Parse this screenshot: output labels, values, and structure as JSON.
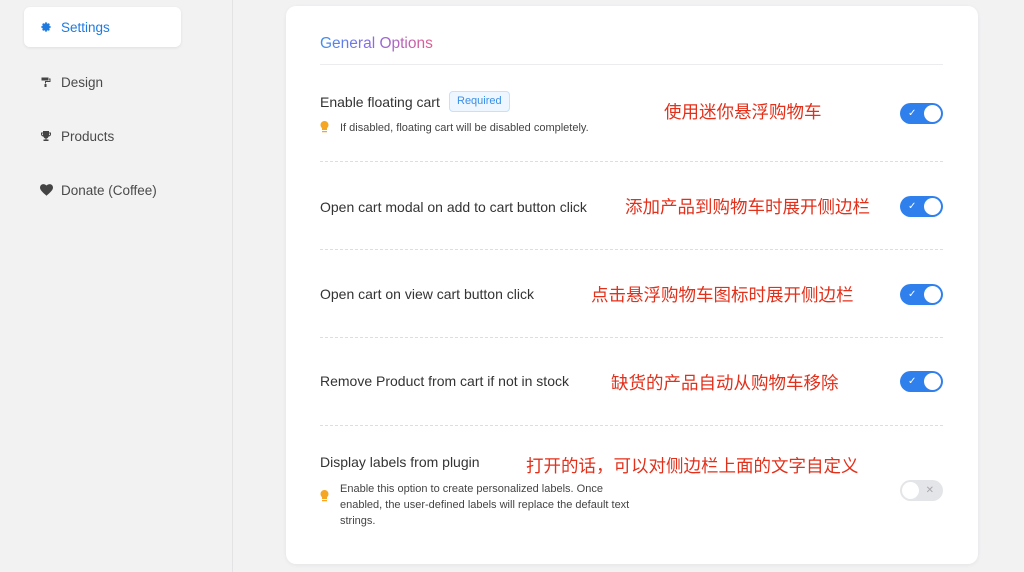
{
  "sidebar": {
    "items": [
      {
        "label": "Settings",
        "icon": "gear-icon",
        "active": true
      },
      {
        "label": "Design",
        "icon": "paint-roller-icon",
        "active": false
      },
      {
        "label": "Products",
        "icon": "trophy-icon",
        "active": false
      },
      {
        "label": "Donate (Coffee)",
        "icon": "heart-icon",
        "active": false
      }
    ]
  },
  "main": {
    "title": "General Options",
    "options": [
      {
        "label": "Enable floating cart",
        "badge": "Required",
        "hint": "If disabled, floating cart will be disabled completely.",
        "annotation": "使用迷你悬浮购物车",
        "enabled": true
      },
      {
        "label": "Open cart modal on add to cart button click",
        "annotation": "添加产品到购物车时展开侧边栏",
        "enabled": true
      },
      {
        "label": "Open cart on view cart button click",
        "annotation": "点击悬浮购物车图标时展开侧边栏",
        "enabled": true
      },
      {
        "label": "Remove Product from cart if not in stock",
        "annotation": "缺货的产品自动从购物车移除",
        "enabled": true
      },
      {
        "label": "Display labels from plugin",
        "hint": "Enable this option to create personalized labels. Once enabled, the user-defined labels will replace the default text strings.",
        "annotation": "打开的话，可以对侧边栏上面的文字自定义",
        "enabled": false
      }
    ],
    "toggle_on_mark": "✓",
    "toggle_off_mark": "✕"
  },
  "colors": {
    "accent": "#2f80ed",
    "annotation": "#e2301b",
    "hint_bulb": "#f5a623"
  }
}
